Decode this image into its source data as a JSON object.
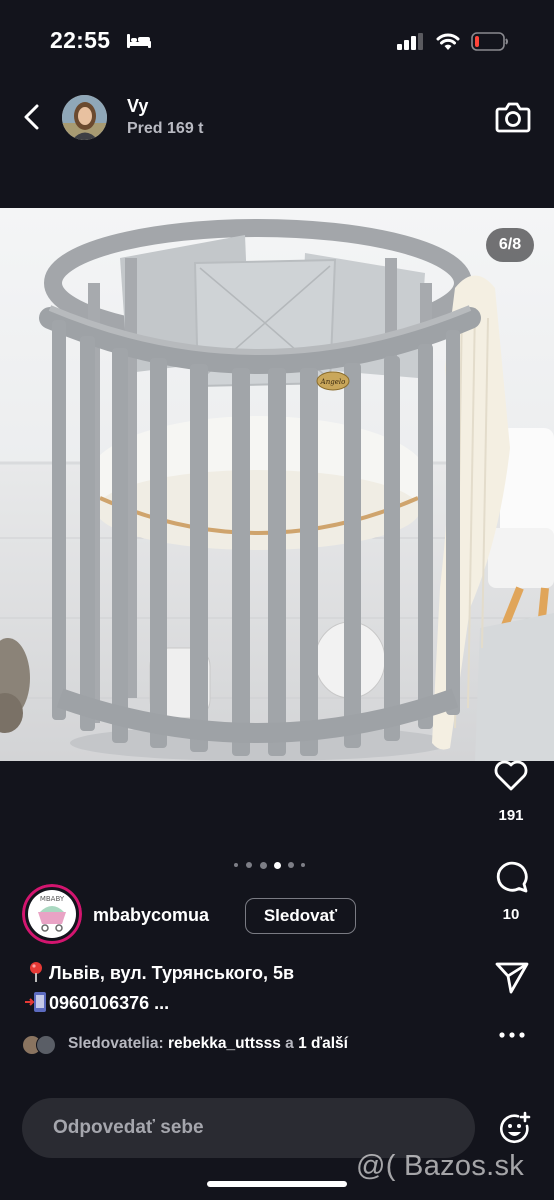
{
  "status_bar": {
    "time": "22:55",
    "icons": [
      "bed-icon",
      "signal-icon",
      "wifi-icon",
      "battery-icon"
    ],
    "battery_color": "#ff453a"
  },
  "header": {
    "name": "Vy",
    "timestamp": "Pred 169 t",
    "icons": [
      "back-icon",
      "camera-icon"
    ]
  },
  "photo": {
    "counter": "6/8",
    "logo_text": "Angelo"
  },
  "actions": {
    "likes": "191",
    "comments": "10",
    "icons": [
      "heart-icon",
      "comment-icon",
      "send-icon",
      "more-icon"
    ]
  },
  "pagination": {
    "total_visible": 6,
    "active_index": 4
  },
  "account": {
    "logo_text": "MBABY",
    "username": "mbabycomua",
    "follow_label": "Sledovať"
  },
  "caption": {
    "line1": "Львів, вул. Турянського, 5в",
    "line2": "0960106376 ..."
  },
  "followers": {
    "prefix": "Sledovatelia:",
    "user": "rebekka_uttsss",
    "connector": "a",
    "more": "1 ďalší"
  },
  "reply": {
    "placeholder": "Odpovedať sebe"
  },
  "watermark": "@( Bazos.sk",
  "colors": {
    "background": "#13141c",
    "input_background": "#2a2b32",
    "account_ring": "#d3156f"
  }
}
